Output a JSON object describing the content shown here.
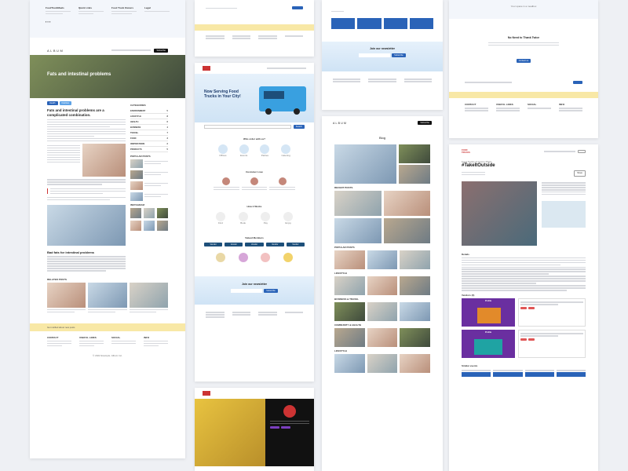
{
  "card1": {
    "footer_top": {
      "col1": "FoodTruckMeals",
      "col2": "Quick Links",
      "col3": "Food Truck Owners",
      "col4": "Legal"
    },
    "nav": {
      "logo": "ALBUM",
      "cta": "Subscribe"
    },
    "hero_title": "Fats and intestinal problems",
    "tags": [
      "Health",
      "Nutrition"
    ],
    "article_title": "Fats and intestinal problems are a complicated combination.",
    "subheading": "Bad fats for intestinal problems",
    "categories_title": "CATEGORIES",
    "categories": [
      {
        "name": "ENVIRONMENT",
        "count": "5"
      },
      {
        "name": "LIFESTYLE",
        "count": "8"
      },
      {
        "name": "HEALTH",
        "count": "6"
      },
      {
        "name": "BUSINESS",
        "count": "4"
      },
      {
        "name": "TRAVEL",
        "count": "7"
      },
      {
        "name": "FOOD",
        "count": "3"
      },
      {
        "name": "INSPIRATIONS",
        "count": "2"
      },
      {
        "name": "PRODUCTS",
        "count": "5"
      }
    ],
    "popular_title": "POPULAR POSTS",
    "instagram_title": "INSTAGRAM",
    "related_title": "RELATED POSTS",
    "newsletter": "Get notified about new posts",
    "footer": {
      "col1": "CONTACT",
      "col2": "USEFUL LINKS",
      "col3": "SOCIAL",
      "col4": "INFO"
    },
    "copyright": "© 2022 Example. Album Inc."
  },
  "card2": {
    "hero_title": "Now Serving Food Trucks in Your City!",
    "search_button": "Search",
    "who_title": "Who order with us?",
    "who_items": [
      "Offices",
      "Events",
      "Parties",
      "Catering"
    ],
    "testimonials_title": "Customer Love",
    "how_title": "How it Works",
    "how_steps": [
      "Find",
      "Book",
      "Pay",
      "Enjoy"
    ],
    "vendors_title": "Valued Members",
    "vendor_buttons": [
      "Vendor",
      "Vendor",
      "Vendor",
      "Vendor",
      "Vendor"
    ],
    "newsletter_title": "Join our newsletter",
    "newsletter_button": "Subscribe"
  },
  "card3": {
    "newsletter_title": "Join our newsletter",
    "subscribe": "Subscribe",
    "nav_logo": "ALBUM",
    "nav_cta": "Subscribe",
    "blog_title": "Blog",
    "sections": [
      "RECENT POSTS",
      "POPULAR POSTS",
      "LIFESTYLE",
      "BUSINESS & TRAVEL",
      "COMMUNITY & HEALTH",
      "LIFESTYLE"
    ]
  },
  "card4": {
    "top_text": "Your space in a mealbox",
    "thank_title": "No Need to Thank Twice",
    "thank_button": "Contact us",
    "footer": {
      "col1": "CONTACT",
      "col2": "USEFUL LINKS",
      "col3": "SOCIAL",
      "col4": "INFO"
    },
    "event_logo": "FOOD TRUCKS",
    "event_sub": "Food Trucks at Grome Plaza",
    "event_title": "#TakeItOutside",
    "share": "Share",
    "details_title": "Details",
    "vendors_title": "Vendors (3)",
    "card_labels": [
      "Profile",
      "Profile"
    ],
    "more_title": "Similar events"
  }
}
